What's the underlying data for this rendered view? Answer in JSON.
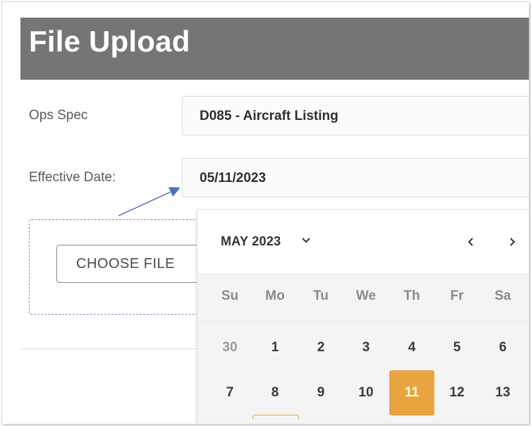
{
  "header": {
    "title": "File Upload"
  },
  "form": {
    "ops_spec": {
      "label": "Ops Spec",
      "value": "D085 - Aircraft Listing"
    },
    "effective_date": {
      "label": "Effective Date:",
      "value": "05/11/2023"
    },
    "choose_file_label": "CHOOSE FILE"
  },
  "calendar": {
    "month_label": "MAY 2023",
    "prev_label": "‹",
    "next_label": "›",
    "weekdays": [
      "Su",
      "Mo",
      "Tu",
      "We",
      "Th",
      "Fr",
      "Sa"
    ],
    "weeks": [
      [
        "30",
        "1",
        "2",
        "3",
        "4",
        "5",
        "6"
      ],
      [
        "7",
        "8",
        "9",
        "10",
        "11",
        "12",
        "13"
      ]
    ],
    "selected_day": "11",
    "colors": {
      "selected": "#e8a43f",
      "header": "#757575",
      "annotation_arrow": "#4a6fc1"
    }
  }
}
